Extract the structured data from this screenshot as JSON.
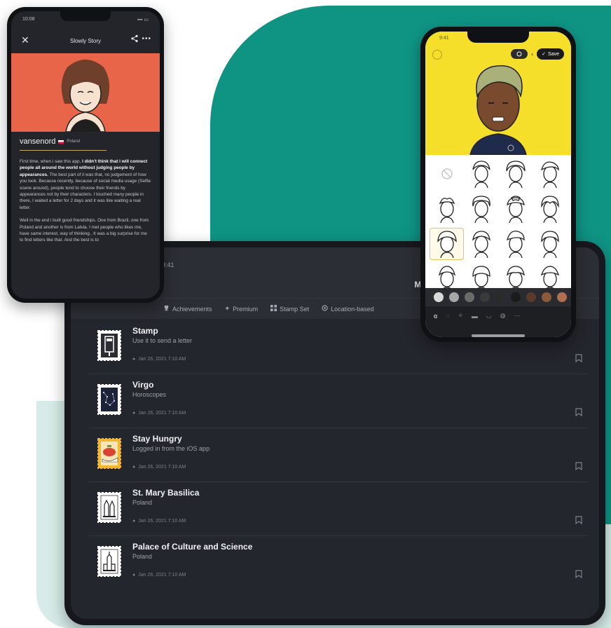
{
  "colors": {
    "teal": "#0f9484",
    "mint": "#d7ece8",
    "hero_orange": "#e9654a",
    "avatar_yellow": "#f6df2b"
  },
  "tablet": {
    "status_time": "9:41",
    "title": "My Stamps",
    "tabs": [
      {
        "label": "Achievements",
        "icon": "trophy-icon"
      },
      {
        "label": "Premium",
        "icon": "star-icon"
      },
      {
        "label": "Stamp Set",
        "icon": "grid-icon"
      },
      {
        "label": "Location-based",
        "icon": "location-icon"
      }
    ],
    "stamps": [
      {
        "name": "Stamp",
        "subtitle": "Use it to send a letter",
        "date": "Jan 26, 2021 7:10 AM",
        "icon": "mailbox-stamp-icon"
      },
      {
        "name": "Virgo",
        "subtitle": "Horoscopes",
        "date": "Jan 26, 2021 7:10 AM",
        "icon": "constellation-stamp-icon"
      },
      {
        "name": "Stay Hungry",
        "subtitle": "Logged in from the iOS app",
        "date": "Jan 26, 2021 7:10 AM",
        "icon": "food-stamp-icon"
      },
      {
        "name": "St. Mary Basilica",
        "subtitle": "Poland",
        "date": "Jan 26, 2021 7:10 AM",
        "icon": "basilica-stamp-icon"
      },
      {
        "name": "Palace of Culture and Science",
        "subtitle": "Poland",
        "date": "Jan 26, 2021 7:10 AM",
        "icon": "palace-stamp-icon"
      }
    ]
  },
  "left_phone": {
    "status_time": "10:08",
    "nav_title": "Slowly Story",
    "username": "vansenord",
    "country": "Poland",
    "story_intro": "First time, when i saw this app, ",
    "story_bold": "I didn't think that I will connect people all around the world without judging people by appearances.",
    "story_rest": " The best part of it was that, no judgement of how you look. Because recently, because of social media usage (Selfie scene around), people tend to choose their friends by appearances not by their characters. I touched many people in there, I waited a letter for 2 days and it was like waiting a real letter.",
    "story_p2": "Well in the end i built good friendships. One from Brazil, one from Poland and another is from Latvia. I met people who likes me, have same interest, way of thinking.. It was a big surprise for me to find letters like that. And the best is to"
  },
  "right_phone": {
    "status_time": "9:41",
    "save_label": "Save",
    "hair_styles": 16,
    "selected_hair_index": 8,
    "swatches": [
      "#d9d9d9",
      "#a7a7a7",
      "#6b6b6b",
      "#3a3a3a",
      "#2a2a2a",
      "#1b1b1b",
      "#5a3a2a",
      "#8b5a3c",
      "#b07050"
    ]
  }
}
